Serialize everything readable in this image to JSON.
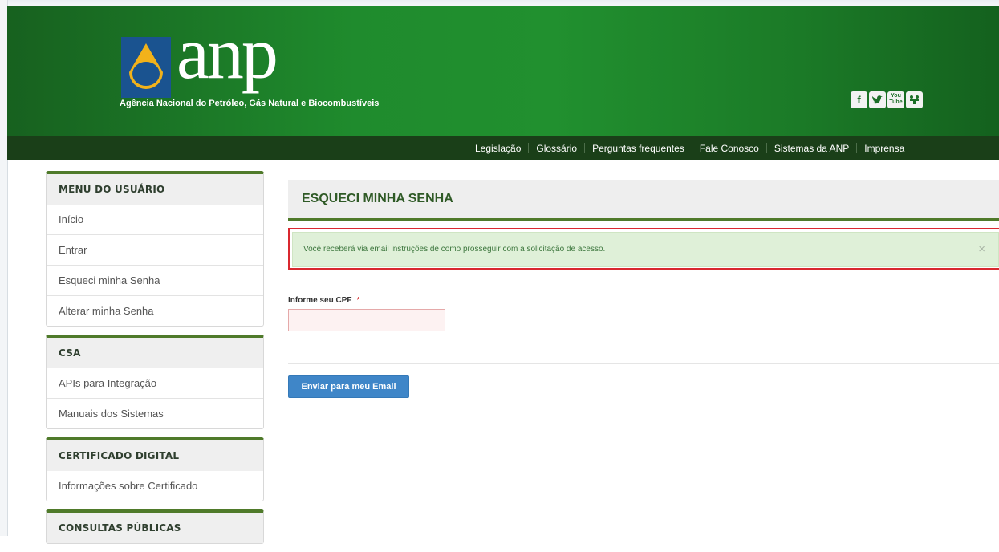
{
  "header": {
    "logo_text": "anp",
    "tagline": "Agência Nacional do Petróleo, Gás Natural e Biocombustíveis",
    "social_icons": [
      "facebook-icon",
      "twitter-icon",
      "youtube-icon",
      "flickr-icon"
    ],
    "youtube_label_top": "You",
    "youtube_label_bottom": "Tube"
  },
  "topnav": {
    "items": [
      "Legislação",
      "Glossário",
      "Perguntas frequentes",
      "Fale Conosco",
      "Sistemas da ANP",
      "Imprensa"
    ]
  },
  "sidebar": {
    "user_menu": {
      "title": "MENU DO USUÁRIO",
      "items": [
        "Início",
        "Entrar",
        "Esqueci minha Senha",
        "Alterar minha Senha"
      ]
    },
    "csa": {
      "title": "CSA",
      "items": [
        "APIs para Integração",
        "Manuais dos Sistemas"
      ]
    },
    "certificado": {
      "title": "CERTIFICADO DIGITAL",
      "items": [
        "Informações sobre Certificado"
      ]
    },
    "consultas": {
      "title": "CONSULTAS PÚBLICAS"
    }
  },
  "main": {
    "title": "ESQUECI MINHA SENHA",
    "alert": "Você receberá via email instruções de como prosseguir com a solicitação de acesso.",
    "alert_close": "×",
    "cpf_label": "Informe seu CPF",
    "required_mark": "*",
    "cpf_value": "",
    "submit_label": "Enviar para meu Email"
  },
  "colors": {
    "header_green": "#1f8b2d",
    "nav_dark": "#1a3f18",
    "accent_green": "#4f7a2a",
    "alert_bg": "#dff0d8",
    "highlight_red": "#d9282f",
    "button_blue": "#3f86c8"
  }
}
